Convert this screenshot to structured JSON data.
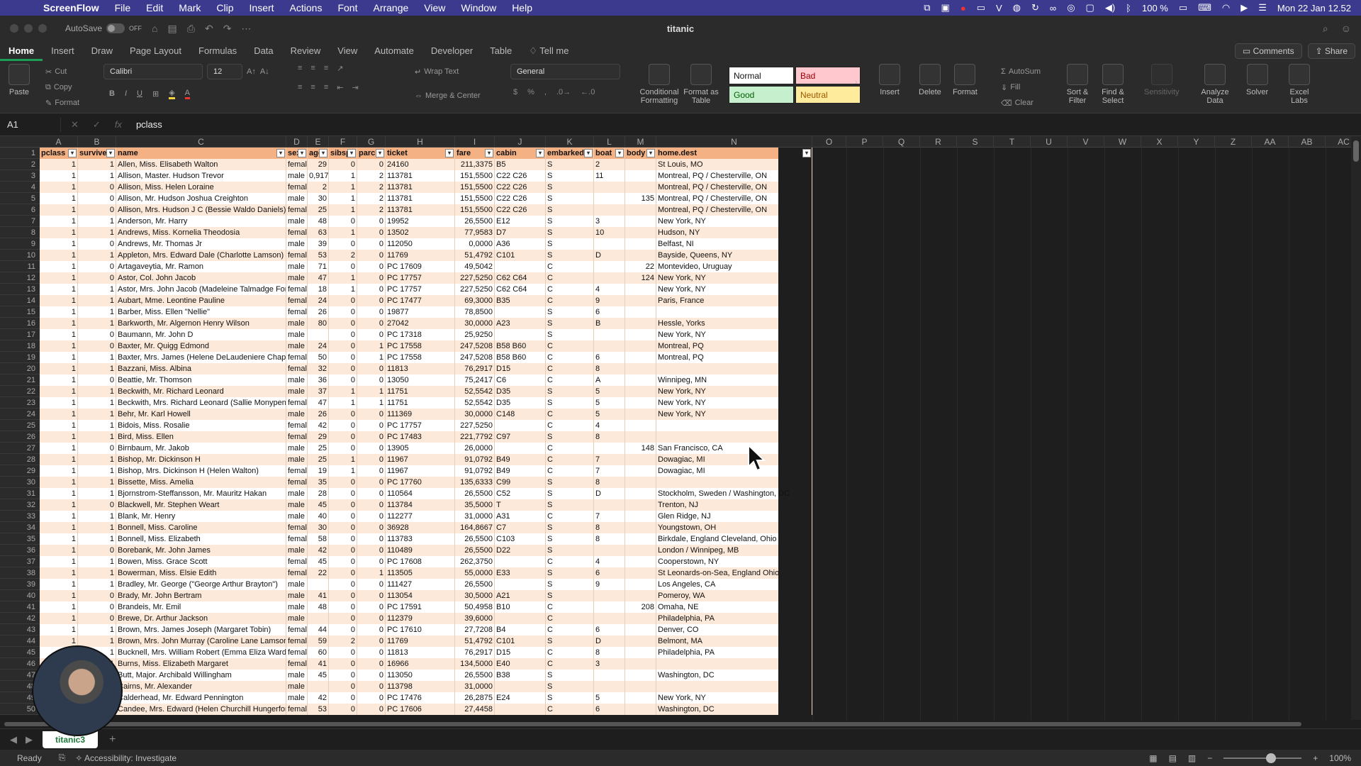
{
  "menubar": {
    "app_name": "ScreenFlow",
    "items": [
      "File",
      "Edit",
      "Mark",
      "Clip",
      "Insert",
      "Actions",
      "Font",
      "Arrange",
      "View",
      "Window",
      "Help"
    ],
    "battery": "100 %",
    "datetime": "Mon 22 Jan  12.52"
  },
  "window": {
    "autosave_label": "AutoSave",
    "autosave_state": "OFF",
    "title": "titanic"
  },
  "ribbon_tabs": [
    "Home",
    "Insert",
    "Draw",
    "Page Layout",
    "Formulas",
    "Data",
    "Review",
    "View",
    "Automate",
    "Developer",
    "Table"
  ],
  "tell_me": "Tell me",
  "comments_label": "Comments",
  "share_label": "Share",
  "ribbon": {
    "paste": "Paste",
    "cut": "Cut",
    "copy": "Copy",
    "format": "Format",
    "font_name": "Calibri",
    "font_size": "12",
    "wrap_text": "Wrap Text",
    "merge_center": "Merge & Center",
    "number_format": "General",
    "conditional_formatting": "Conditional Formatting",
    "format_as_table": "Format as Table",
    "style_normal": "Normal",
    "style_bad": "Bad",
    "style_good": "Good",
    "style_neutral": "Neutral",
    "insert": "Insert",
    "delete": "Delete",
    "format_cells": "Format",
    "autosum": "AutoSum",
    "fill": "Fill",
    "clear": "Clear",
    "sort_filter": "Sort & Filter",
    "find_select": "Find & Select",
    "sensitivity": "Sensitivity",
    "analyze_data": "Analyze Data",
    "solver": "Solver",
    "excel_labs": "Excel Labs"
  },
  "formula_bar": {
    "cell_ref": "A1",
    "fx": "fx",
    "value": "pclass"
  },
  "columns": [
    "A",
    "B",
    "C",
    "D",
    "E",
    "F",
    "G",
    "H",
    "I",
    "J",
    "K",
    "L",
    "M",
    "N",
    "O",
    "P",
    "Q",
    "R",
    "S",
    "T",
    "U",
    "V",
    "W",
    "X",
    "Y",
    "Z",
    "AA",
    "AB",
    "AC"
  ],
  "headers": [
    "pclass",
    "survived",
    "name",
    "sex",
    "age",
    "sibsp",
    "parch",
    "ticket",
    "fare",
    "cabin",
    "embarked",
    "boat",
    "body",
    "home.dest"
  ],
  "rows": [
    [
      "1",
      "1",
      "Allen, Miss. Elisabeth Walton",
      "female",
      "29",
      "0",
      "0",
      "24160",
      "211,3375",
      "B5",
      "S",
      "2",
      "",
      "St Louis, MO"
    ],
    [
      "1",
      "1",
      "Allison, Master. Hudson Trevor",
      "male",
      "0,917",
      "1",
      "2",
      "113781",
      "151,5500",
      "C22 C26",
      "S",
      "11",
      "",
      "Montreal, PQ / Chesterville, ON"
    ],
    [
      "1",
      "0",
      "Allison, Miss. Helen Loraine",
      "female",
      "2",
      "1",
      "2",
      "113781",
      "151,5500",
      "C22 C26",
      "S",
      "",
      "",
      "Montreal, PQ / Chesterville, ON"
    ],
    [
      "1",
      "0",
      "Allison, Mr. Hudson Joshua Creighton",
      "male",
      "30",
      "1",
      "2",
      "113781",
      "151,5500",
      "C22 C26",
      "S",
      "",
      "135",
      "Montreal, PQ / Chesterville, ON"
    ],
    [
      "1",
      "0",
      "Allison, Mrs. Hudson J C (Bessie Waldo Daniels)",
      "female",
      "25",
      "1",
      "2",
      "113781",
      "151,5500",
      "C22 C26",
      "S",
      "",
      "",
      "Montreal, PQ / Chesterville, ON"
    ],
    [
      "1",
      "1",
      "Anderson, Mr. Harry",
      "male",
      "48",
      "0",
      "0",
      "19952",
      "26,5500",
      "E12",
      "S",
      "3",
      "",
      "New York, NY"
    ],
    [
      "1",
      "1",
      "Andrews, Miss. Kornelia Theodosia",
      "female",
      "63",
      "1",
      "0",
      "13502",
      "77,9583",
      "D7",
      "S",
      "10",
      "",
      "Hudson, NY"
    ],
    [
      "1",
      "0",
      "Andrews, Mr. Thomas Jr",
      "male",
      "39",
      "0",
      "0",
      "112050",
      "0,0000",
      "A36",
      "S",
      "",
      "",
      "Belfast, NI"
    ],
    [
      "1",
      "1",
      "Appleton, Mrs. Edward Dale (Charlotte Lamson)",
      "female",
      "53",
      "2",
      "0",
      "11769",
      "51,4792",
      "C101",
      "S",
      "D",
      "",
      "Bayside, Queens, NY"
    ],
    [
      "1",
      "0",
      "Artagaveytia, Mr. Ramon",
      "male",
      "71",
      "0",
      "0",
      "PC 17609",
      "49,5042",
      "",
      "C",
      "",
      "22",
      "Montevideo, Uruguay"
    ],
    [
      "1",
      "0",
      "Astor, Col. John Jacob",
      "male",
      "47",
      "1",
      "0",
      "PC 17757",
      "227,5250",
      "C62 C64",
      "C",
      "",
      "124",
      "New York, NY"
    ],
    [
      "1",
      "1",
      "Astor, Mrs. John Jacob (Madeleine Talmadge Force)",
      "female",
      "18",
      "1",
      "0",
      "PC 17757",
      "227,5250",
      "C62 C64",
      "C",
      "4",
      "",
      "New York, NY"
    ],
    [
      "1",
      "1",
      "Aubart, Mme. Leontine Pauline",
      "female",
      "24",
      "0",
      "0",
      "PC 17477",
      "69,3000",
      "B35",
      "C",
      "9",
      "",
      "Paris, France"
    ],
    [
      "1",
      "1",
      "Barber, Miss. Ellen \"Nellie\"",
      "female",
      "26",
      "0",
      "0",
      "19877",
      "78,8500",
      "",
      "S",
      "6",
      "",
      ""
    ],
    [
      "1",
      "1",
      "Barkworth, Mr. Algernon Henry Wilson",
      "male",
      "80",
      "0",
      "0",
      "27042",
      "30,0000",
      "A23",
      "S",
      "B",
      "",
      "Hessle, Yorks"
    ],
    [
      "1",
      "0",
      "Baumann, Mr. John D",
      "male",
      "",
      "0",
      "0",
      "PC 17318",
      "25,9250",
      "",
      "S",
      "",
      "",
      "New York, NY"
    ],
    [
      "1",
      "0",
      "Baxter, Mr. Quigg Edmond",
      "male",
      "24",
      "0",
      "1",
      "PC 17558",
      "247,5208",
      "B58 B60",
      "C",
      "",
      "",
      "Montreal, PQ"
    ],
    [
      "1",
      "1",
      "Baxter, Mrs. James (Helene DeLaudeniere Chaput)",
      "female",
      "50",
      "0",
      "1",
      "PC 17558",
      "247,5208",
      "B58 B60",
      "C",
      "6",
      "",
      "Montreal, PQ"
    ],
    [
      "1",
      "1",
      "Bazzani, Miss. Albina",
      "female",
      "32",
      "0",
      "0",
      "11813",
      "76,2917",
      "D15",
      "C",
      "8",
      "",
      ""
    ],
    [
      "1",
      "0",
      "Beattie, Mr. Thomson",
      "male",
      "36",
      "0",
      "0",
      "13050",
      "75,2417",
      "C6",
      "C",
      "A",
      "",
      "Winnipeg, MN"
    ],
    [
      "1",
      "1",
      "Beckwith, Mr. Richard Leonard",
      "male",
      "37",
      "1",
      "1",
      "11751",
      "52,5542",
      "D35",
      "S",
      "5",
      "",
      "New York, NY"
    ],
    [
      "1",
      "1",
      "Beckwith, Mrs. Richard Leonard (Sallie Monypeny)",
      "female",
      "47",
      "1",
      "1",
      "11751",
      "52,5542",
      "D35",
      "S",
      "5",
      "",
      "New York, NY"
    ],
    [
      "1",
      "1",
      "Behr, Mr. Karl Howell",
      "male",
      "26",
      "0",
      "0",
      "111369",
      "30,0000",
      "C148",
      "C",
      "5",
      "",
      "New York, NY"
    ],
    [
      "1",
      "1",
      "Bidois, Miss. Rosalie",
      "female",
      "42",
      "0",
      "0",
      "PC 17757",
      "227,5250",
      "",
      "C",
      "4",
      "",
      ""
    ],
    [
      "1",
      "1",
      "Bird, Miss. Ellen",
      "female",
      "29",
      "0",
      "0",
      "PC 17483",
      "221,7792",
      "C97",
      "S",
      "8",
      "",
      ""
    ],
    [
      "1",
      "0",
      "Birnbaum, Mr. Jakob",
      "male",
      "25",
      "0",
      "0",
      "13905",
      "26,0000",
      "",
      "C",
      "",
      "148",
      "San Francisco, CA"
    ],
    [
      "1",
      "1",
      "Bishop, Mr. Dickinson H",
      "male",
      "25",
      "1",
      "0",
      "11967",
      "91,0792",
      "B49",
      "C",
      "7",
      "",
      "Dowagiac, MI"
    ],
    [
      "1",
      "1",
      "Bishop, Mrs. Dickinson H (Helen Walton)",
      "female",
      "19",
      "1",
      "0",
      "11967",
      "91,0792",
      "B49",
      "C",
      "7",
      "",
      "Dowagiac, MI"
    ],
    [
      "1",
      "1",
      "Bissette, Miss. Amelia",
      "female",
      "35",
      "0",
      "0",
      "PC 17760",
      "135,6333",
      "C99",
      "S",
      "8",
      "",
      ""
    ],
    [
      "1",
      "1",
      "Bjornstrom-Steffansson, Mr. Mauritz Hakan",
      "male",
      "28",
      "0",
      "0",
      "110564",
      "26,5500",
      "C52",
      "S",
      "D",
      "",
      "Stockholm, Sweden / Washington, DC"
    ],
    [
      "1",
      "0",
      "Blackwell, Mr. Stephen Weart",
      "male",
      "45",
      "0",
      "0",
      "113784",
      "35,5000",
      "T",
      "S",
      "",
      "",
      "Trenton, NJ"
    ],
    [
      "1",
      "1",
      "Blank, Mr. Henry",
      "male",
      "40",
      "0",
      "0",
      "112277",
      "31,0000",
      "A31",
      "C",
      "7",
      "",
      "Glen Ridge, NJ"
    ],
    [
      "1",
      "1",
      "Bonnell, Miss. Caroline",
      "female",
      "30",
      "0",
      "0",
      "36928",
      "164,8667",
      "C7",
      "S",
      "8",
      "",
      "Youngstown, OH"
    ],
    [
      "1",
      "1",
      "Bonnell, Miss. Elizabeth",
      "female",
      "58",
      "0",
      "0",
      "113783",
      "26,5500",
      "C103",
      "S",
      "8",
      "",
      "Birkdale, England Cleveland, Ohio"
    ],
    [
      "1",
      "0",
      "Borebank, Mr. John James",
      "male",
      "42",
      "0",
      "0",
      "110489",
      "26,5500",
      "D22",
      "S",
      "",
      "",
      "London / Winnipeg, MB"
    ],
    [
      "1",
      "1",
      "Bowen, Miss. Grace Scott",
      "female",
      "45",
      "0",
      "0",
      "PC 17608",
      "262,3750",
      "",
      "C",
      "4",
      "",
      "Cooperstown, NY"
    ],
    [
      "1",
      "1",
      "Bowerman, Miss. Elsie Edith",
      "female",
      "22",
      "0",
      "1",
      "113505",
      "55,0000",
      "E33",
      "S",
      "6",
      "",
      "St Leonards-on-Sea, England Ohio"
    ],
    [
      "1",
      "1",
      "Bradley, Mr. George (\"George Arthur Brayton\")",
      "male",
      "",
      "0",
      "0",
      "111427",
      "26,5500",
      "",
      "S",
      "9",
      "",
      "Los Angeles, CA"
    ],
    [
      "1",
      "0",
      "Brady, Mr. John Bertram",
      "male",
      "41",
      "0",
      "0",
      "113054",
      "30,5000",
      "A21",
      "S",
      "",
      "",
      "Pomeroy, WA"
    ],
    [
      "1",
      "0",
      "Brandeis, Mr. Emil",
      "male",
      "48",
      "0",
      "0",
      "PC 17591",
      "50,4958",
      "B10",
      "C",
      "",
      "208",
      "Omaha, NE"
    ],
    [
      "1",
      "0",
      "Brewe, Dr. Arthur Jackson",
      "male",
      "",
      "0",
      "0",
      "112379",
      "39,6000",
      "",
      "C",
      "",
      "",
      "Philadelphia, PA"
    ],
    [
      "1",
      "1",
      "Brown, Mrs. James Joseph (Margaret Tobin)",
      "female",
      "44",
      "0",
      "0",
      "PC 17610",
      "27,7208",
      "B4",
      "C",
      "6",
      "",
      "Denver, CO"
    ],
    [
      "1",
      "1",
      "Brown, Mrs. John Murray (Caroline Lane Lamson)",
      "female",
      "59",
      "2",
      "0",
      "11769",
      "51,4792",
      "C101",
      "S",
      "D",
      "",
      "Belmont, MA"
    ],
    [
      "1",
      "1",
      "Bucknell, Mrs. William Robert (Emma Eliza Ward)",
      "female",
      "60",
      "0",
      "0",
      "11813",
      "76,2917",
      "D15",
      "C",
      "8",
      "",
      "Philadelphia, PA"
    ],
    [
      "1",
      "1",
      "Burns, Miss. Elizabeth Margaret",
      "female",
      "41",
      "0",
      "0",
      "16966",
      "134,5000",
      "E40",
      "C",
      "3",
      "",
      ""
    ],
    [
      "1",
      "0",
      "Butt, Major. Archibald Willingham",
      "male",
      "45",
      "0",
      "0",
      "113050",
      "26,5500",
      "B38",
      "S",
      "",
      "",
      "Washington, DC"
    ],
    [
      "1",
      "0",
      "Cairns, Mr. Alexander",
      "male",
      "",
      "0",
      "0",
      "113798",
      "31,0000",
      "",
      "S",
      "",
      "",
      ""
    ],
    [
      "1",
      "1",
      "Calderhead, Mr. Edward Pennington",
      "male",
      "42",
      "0",
      "0",
      "PC 17476",
      "26,2875",
      "E24",
      "S",
      "5",
      "",
      "New York, NY"
    ],
    [
      "1",
      "1",
      "Candee, Mrs. Edward (Helen Churchill Hungerford)",
      "female",
      "53",
      "0",
      "0",
      "PC 17606",
      "27,4458",
      "",
      "C",
      "6",
      "",
      "Washington, DC"
    ]
  ],
  "sheet_tab": "titanic3",
  "status": {
    "ready": "Ready",
    "accessibility": "Accessibility: Investigate",
    "zoom": "100%"
  }
}
